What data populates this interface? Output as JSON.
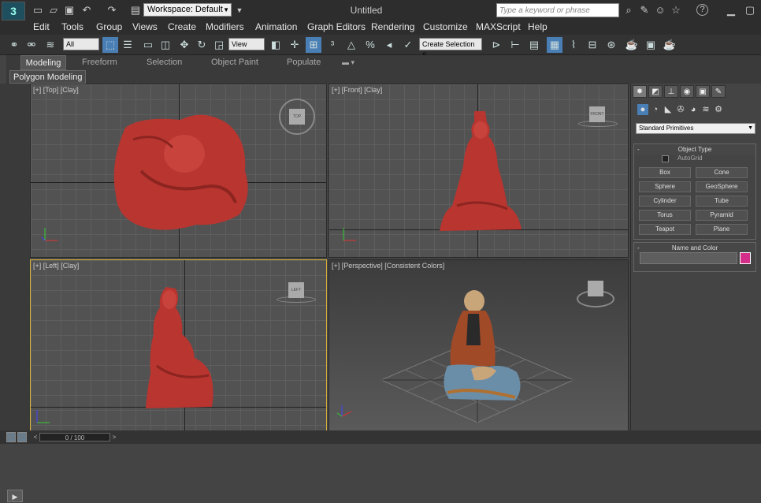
{
  "titlebar": {
    "logo": "3",
    "workspace_label": "Workspace: Default",
    "title": "Untitled",
    "search_placeholder": "Type a keyword or phrase",
    "help_label": "?"
  },
  "menu": [
    "Edit",
    "Tools",
    "Group",
    "Views",
    "Create",
    "Modifiers",
    "Animation",
    "Graph Editors",
    "Rendering",
    "Customize",
    "MAXScript",
    "Help"
  ],
  "toolbar": {
    "filter_value": "All",
    "view_value": "View",
    "selection_set_placeholder": "Create Selection S"
  },
  "ribbon": {
    "tabs": [
      "Modeling",
      "Freeform",
      "Selection",
      "Object Paint",
      "Populate"
    ],
    "active": "Modeling",
    "panel_label": "Polygon Modeling"
  },
  "viewports": {
    "top": "[+] [Top] [Clay]",
    "front": "[+] [Front] [Clay]",
    "left": "[+] [Left] [Clay]",
    "perspective": "[+] [Perspective] [Consistent Colors]",
    "cube_top": "TOP",
    "cube_front": "FRONT",
    "cube_left": "LEFT"
  },
  "command_panel": {
    "primitive_type": "Standard Primitives",
    "object_type_title": "Object Type",
    "autogrid_label": "AutoGrid",
    "buttons": [
      "Box",
      "Cone",
      "Sphere",
      "GeoSphere",
      "Cylinder",
      "Tube",
      "Torus",
      "Pyramid",
      "Teapot",
      "Plane"
    ],
    "name_color_title": "Name and Color",
    "object_color": "#d42e8a"
  },
  "timeline": {
    "frame": "0 / 100"
  },
  "colors": {
    "statue_clay": "#b83530",
    "active_viewport_border": "#d8b338"
  }
}
